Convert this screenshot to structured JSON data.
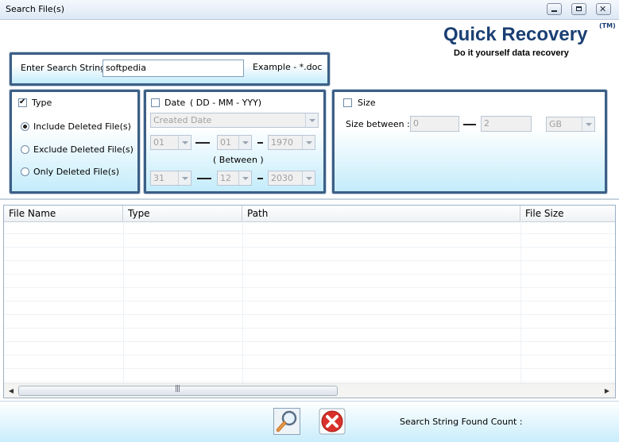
{
  "window": {
    "title": "Search File(s)"
  },
  "logo": {
    "title": "Quick Recovery",
    "tm": "(TM)",
    "tagline": "Do it yourself data recovery"
  },
  "search": {
    "label": "Enter Search String",
    "value": "softpedia",
    "example": "Example - *.doc"
  },
  "type_filter": {
    "label": "Type",
    "checked": true,
    "options": [
      {
        "label": "Include Deleted File(s)",
        "selected": true
      },
      {
        "label": "Exclude Deleted File(s)",
        "selected": false
      },
      {
        "label": "Only Deleted File(s)",
        "selected": false
      }
    ]
  },
  "date_filter": {
    "label": "Date",
    "format_hint": "( DD - MM - YYY)",
    "checked": false,
    "date_kind": "Created Date",
    "from": {
      "day": "01",
      "month": "01",
      "year": "1970"
    },
    "between_label": "( Between )",
    "to": {
      "day": "31",
      "month": "12",
      "year": "2030"
    }
  },
  "size_filter": {
    "label": "Size",
    "checked": false,
    "between_label": "Size between :",
    "min": "0",
    "max": "2",
    "unit": "GB"
  },
  "results_table": {
    "columns": [
      "File Name",
      "Type",
      "Path",
      "File Size"
    ],
    "rows": []
  },
  "footer": {
    "found_label": "Search String Found Count :"
  },
  "colors": {
    "panel_border": "#3c5f86",
    "panel_gradient_end": "#c4ecfb",
    "logo_blue": "#1a3f73",
    "close_red": "#d9312b"
  }
}
